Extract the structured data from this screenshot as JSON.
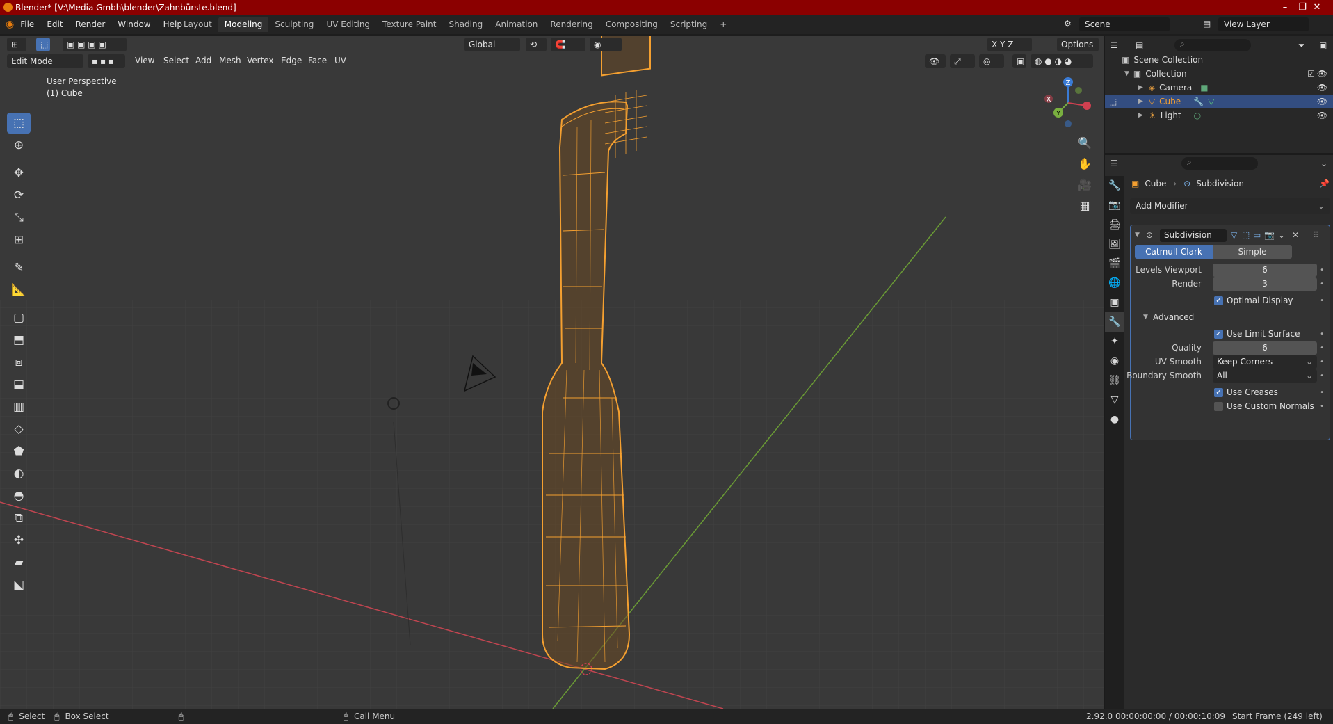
{
  "window": {
    "title": "Blender* [V:\\Media Gmbh\\blender\\Zahnbürste.blend]",
    "controls": [
      "–",
      "❐",
      "✕"
    ]
  },
  "menubar": {
    "items": [
      "File",
      "Edit",
      "Render",
      "Window",
      "Help"
    ],
    "workspaces": [
      "Layout",
      "Modeling",
      "Sculpting",
      "UV Editing",
      "Texture Paint",
      "Shading",
      "Animation",
      "Rendering",
      "Compositing",
      "Scripting"
    ],
    "active_workspace": "Modeling",
    "add_workspace": "+",
    "scene": "Scene",
    "view_layer": "View Layer"
  },
  "viewport": {
    "mode": "Edit Mode",
    "menus": [
      "View",
      "Select",
      "Add",
      "Mesh",
      "Vertex",
      "Edge",
      "Face",
      "UV"
    ],
    "orientation": "Global",
    "options_label": "Options",
    "axes": [
      "X",
      "Y",
      "Z"
    ],
    "info_line1": "User Perspective",
    "info_line2": "(1) Cube",
    "gizmo": {
      "x": "X",
      "y": "Y",
      "z": "Z"
    }
  },
  "outliner": {
    "root": "Scene Collection",
    "collection": "Collection",
    "items": [
      {
        "name": "Camera",
        "selected": false
      },
      {
        "name": "Cube",
        "selected": true
      },
      {
        "name": "Light",
        "selected": false
      }
    ]
  },
  "properties": {
    "breadcrumb_object": "Cube",
    "breadcrumb_modifier": "Subdivision",
    "add_modifier": "Add Modifier",
    "modifier": {
      "name": "Subdivision",
      "type_options": [
        "Catmull-Clark",
        "Simple"
      ],
      "active_type": "Catmull-Clark",
      "levels_viewport_label": "Levels Viewport",
      "levels_viewport": "6",
      "render_label": "Render",
      "render": "3",
      "optimal_display_label": "Optimal Display",
      "optimal_display": true,
      "advanced_label": "Advanced",
      "use_limit_surface_label": "Use Limit Surface",
      "use_limit_surface": true,
      "quality_label": "Quality",
      "quality": "6",
      "uv_smooth_label": "UV Smooth",
      "uv_smooth": "Keep Corners",
      "boundary_smooth_label": "Boundary Smooth",
      "boundary_smooth": "All",
      "use_creases_label": "Use Creases",
      "use_creases": true,
      "use_custom_normals_label": "Use Custom Normals",
      "use_custom_normals": false
    }
  },
  "statusbar": {
    "select": "Select",
    "box_select": "Box Select",
    "call_menu": "Call Menu",
    "info": "2.92.0  00:00:00:00 / 00:00:10:09",
    "frame": "Start Frame (249 left)"
  },
  "colors": {
    "accent": "#4772b3",
    "selection_orange": "#f5a030",
    "titlebar": "#8b0000",
    "x_axis": "#d04050",
    "y_axis": "#7ab040",
    "z_axis": "#3a7bd5"
  }
}
